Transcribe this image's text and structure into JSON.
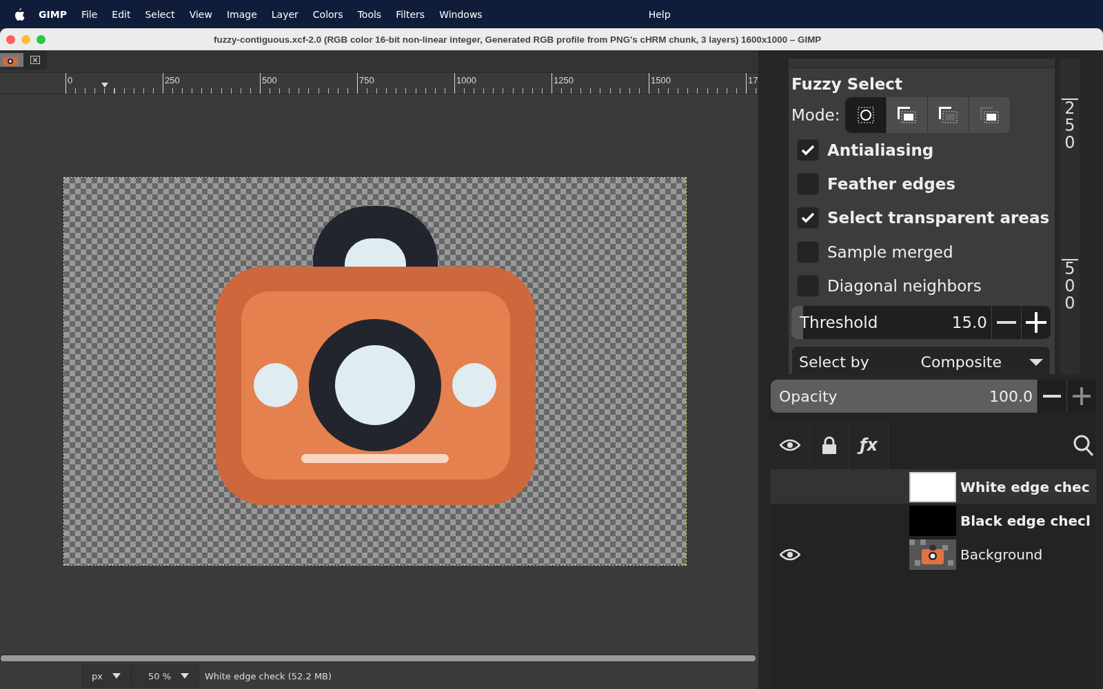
{
  "menu_bar": {
    "app_name": "GIMP",
    "items": [
      "File",
      "Edit",
      "Select",
      "View",
      "Image",
      "Layer",
      "Colors",
      "Tools",
      "Filters",
      "Windows"
    ],
    "help": "Help"
  },
  "window": {
    "title": "fuzzy-contiguous.xcf-2.0 (RGB color 16-bit non-linear integer, Generated RGB profile from PNG's cHRM chunk, 3 layers) 1600x1000 – GIMP"
  },
  "ruler": {
    "labels": [
      "0",
      "250",
      "500",
      "750",
      "1000",
      "1250",
      "1500",
      "17"
    ]
  },
  "status_bar": {
    "unit": "px",
    "zoom": "50 %",
    "message": "White edge check (52.2 MB)"
  },
  "tool_options": {
    "title": "Fuzzy Select",
    "mode_label": "Mode:",
    "modes": [
      {
        "kind": "replace",
        "selected": true
      },
      {
        "kind": "add",
        "selected": false
      },
      {
        "kind": "subtract",
        "selected": false
      },
      {
        "kind": "intersect",
        "selected": false
      }
    ],
    "options": [
      {
        "label": "Antialiasing",
        "checked": true,
        "modified": true
      },
      {
        "label": "Feather edges",
        "checked": false,
        "modified": true
      },
      {
        "label": "Select transparent areas",
        "checked": true,
        "modified": true
      },
      {
        "label": "Sample merged",
        "checked": false,
        "modified": false
      },
      {
        "label": "Diagonal neighbors",
        "checked": false,
        "modified": false
      }
    ],
    "threshold": {
      "label": "Threshold",
      "value": "15.0",
      "level": 0.06
    },
    "select_by": {
      "label": "Select by",
      "value": "Composite"
    }
  },
  "vertical_ruler": {
    "labels": [
      "250",
      "500"
    ]
  },
  "layers": {
    "opacity": {
      "label": "Opacity",
      "value": "100.0",
      "level": 1.0
    },
    "fx_label": "ƒx",
    "items": [
      {
        "name": "White edge chec",
        "visible": false,
        "selected": true,
        "modified": true,
        "kind": "white"
      },
      {
        "name": "Black edge checl",
        "visible": false,
        "selected": false,
        "modified": true,
        "kind": "black"
      },
      {
        "name": "Background",
        "visible": true,
        "selected": false,
        "modified": false,
        "kind": "image"
      }
    ]
  }
}
